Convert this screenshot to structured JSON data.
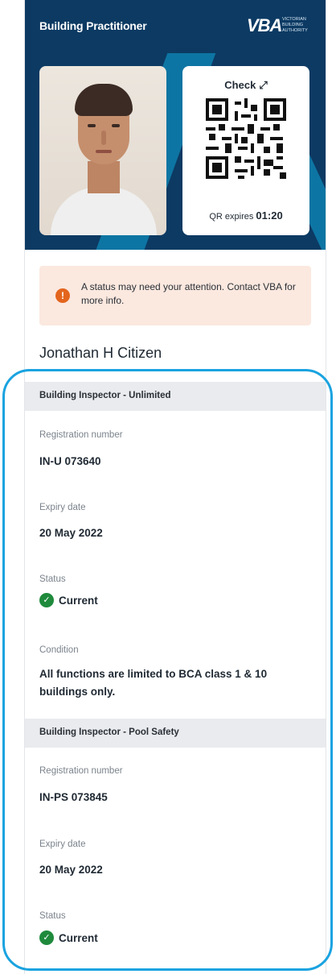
{
  "header": {
    "title": "Building Practitioner",
    "logo_mark": "VBA",
    "logo_text": "Victorian Building Authority"
  },
  "hero": {
    "check_label": "Check",
    "qr_expiry_label": "QR expires",
    "qr_expiry_time": "01:20"
  },
  "notice": {
    "text": "A status may need your attention. Contact VBA for more info."
  },
  "holder": {
    "name": "Jonathan H Citizen"
  },
  "registrations": [
    {
      "title": "Building Inspector - Unlimited",
      "registration_label": "Registration number",
      "registration_number": "IN-U 073640",
      "expiry_label": "Expiry date",
      "expiry_date": "20 May 2022",
      "status_label": "Status",
      "status_value": "Current",
      "condition_label": "Condition",
      "condition_value": "All functions are limited to BCA class 1 & 10 buildings only."
    },
    {
      "title": "Building Inspector - Pool Safety",
      "registration_label": "Registration number",
      "registration_number": "IN-PS 073845",
      "expiry_label": "Expiry date",
      "expiry_date": "20 May 2022",
      "status_label": "Status",
      "status_value": "Current"
    }
  ],
  "colors": {
    "navy": "#0c3a63",
    "accent": "#1aa3e0",
    "success": "#1f8a3c",
    "warning": "#e3651d",
    "notice_bg": "#fbe8df"
  },
  "icons": [
    "expand-icon",
    "alert-icon",
    "check-circle-icon"
  ]
}
